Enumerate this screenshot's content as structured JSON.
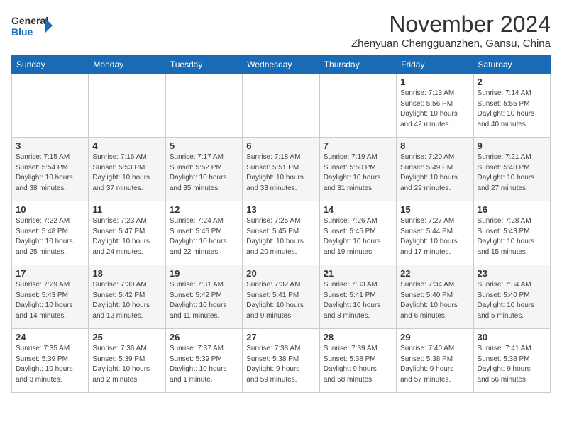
{
  "header": {
    "logo_line1": "General",
    "logo_line2": "Blue",
    "month": "November 2024",
    "location": "Zhenyuan Chengguanzhen, Gansu, China"
  },
  "weekdays": [
    "Sunday",
    "Monday",
    "Tuesday",
    "Wednesday",
    "Thursday",
    "Friday",
    "Saturday"
  ],
  "weeks": [
    [
      {
        "day": "",
        "info": ""
      },
      {
        "day": "",
        "info": ""
      },
      {
        "day": "",
        "info": ""
      },
      {
        "day": "",
        "info": ""
      },
      {
        "day": "",
        "info": ""
      },
      {
        "day": "1",
        "info": "Sunrise: 7:13 AM\nSunset: 5:56 PM\nDaylight: 10 hours\nand 42 minutes."
      },
      {
        "day": "2",
        "info": "Sunrise: 7:14 AM\nSunset: 5:55 PM\nDaylight: 10 hours\nand 40 minutes."
      }
    ],
    [
      {
        "day": "3",
        "info": "Sunrise: 7:15 AM\nSunset: 5:54 PM\nDaylight: 10 hours\nand 38 minutes."
      },
      {
        "day": "4",
        "info": "Sunrise: 7:16 AM\nSunset: 5:53 PM\nDaylight: 10 hours\nand 37 minutes."
      },
      {
        "day": "5",
        "info": "Sunrise: 7:17 AM\nSunset: 5:52 PM\nDaylight: 10 hours\nand 35 minutes."
      },
      {
        "day": "6",
        "info": "Sunrise: 7:18 AM\nSunset: 5:51 PM\nDaylight: 10 hours\nand 33 minutes."
      },
      {
        "day": "7",
        "info": "Sunrise: 7:19 AM\nSunset: 5:50 PM\nDaylight: 10 hours\nand 31 minutes."
      },
      {
        "day": "8",
        "info": "Sunrise: 7:20 AM\nSunset: 5:49 PM\nDaylight: 10 hours\nand 29 minutes."
      },
      {
        "day": "9",
        "info": "Sunrise: 7:21 AM\nSunset: 5:48 PM\nDaylight: 10 hours\nand 27 minutes."
      }
    ],
    [
      {
        "day": "10",
        "info": "Sunrise: 7:22 AM\nSunset: 5:48 PM\nDaylight: 10 hours\nand 25 minutes."
      },
      {
        "day": "11",
        "info": "Sunrise: 7:23 AM\nSunset: 5:47 PM\nDaylight: 10 hours\nand 24 minutes."
      },
      {
        "day": "12",
        "info": "Sunrise: 7:24 AM\nSunset: 5:46 PM\nDaylight: 10 hours\nand 22 minutes."
      },
      {
        "day": "13",
        "info": "Sunrise: 7:25 AM\nSunset: 5:45 PM\nDaylight: 10 hours\nand 20 minutes."
      },
      {
        "day": "14",
        "info": "Sunrise: 7:26 AM\nSunset: 5:45 PM\nDaylight: 10 hours\nand 19 minutes."
      },
      {
        "day": "15",
        "info": "Sunrise: 7:27 AM\nSunset: 5:44 PM\nDaylight: 10 hours\nand 17 minutes."
      },
      {
        "day": "16",
        "info": "Sunrise: 7:28 AM\nSunset: 5:43 PM\nDaylight: 10 hours\nand 15 minutes."
      }
    ],
    [
      {
        "day": "17",
        "info": "Sunrise: 7:29 AM\nSunset: 5:43 PM\nDaylight: 10 hours\nand 14 minutes."
      },
      {
        "day": "18",
        "info": "Sunrise: 7:30 AM\nSunset: 5:42 PM\nDaylight: 10 hours\nand 12 minutes."
      },
      {
        "day": "19",
        "info": "Sunrise: 7:31 AM\nSunset: 5:42 PM\nDaylight: 10 hours\nand 11 minutes."
      },
      {
        "day": "20",
        "info": "Sunrise: 7:32 AM\nSunset: 5:41 PM\nDaylight: 10 hours\nand 9 minutes."
      },
      {
        "day": "21",
        "info": "Sunrise: 7:33 AM\nSunset: 5:41 PM\nDaylight: 10 hours\nand 8 minutes."
      },
      {
        "day": "22",
        "info": "Sunrise: 7:34 AM\nSunset: 5:40 PM\nDaylight: 10 hours\nand 6 minutes."
      },
      {
        "day": "23",
        "info": "Sunrise: 7:34 AM\nSunset: 5:40 PM\nDaylight: 10 hours\nand 5 minutes."
      }
    ],
    [
      {
        "day": "24",
        "info": "Sunrise: 7:35 AM\nSunset: 5:39 PM\nDaylight: 10 hours\nand 3 minutes."
      },
      {
        "day": "25",
        "info": "Sunrise: 7:36 AM\nSunset: 5:39 PM\nDaylight: 10 hours\nand 2 minutes."
      },
      {
        "day": "26",
        "info": "Sunrise: 7:37 AM\nSunset: 5:39 PM\nDaylight: 10 hours\nand 1 minute."
      },
      {
        "day": "27",
        "info": "Sunrise: 7:38 AM\nSunset: 5:38 PM\nDaylight: 9 hours\nand 59 minutes."
      },
      {
        "day": "28",
        "info": "Sunrise: 7:39 AM\nSunset: 5:38 PM\nDaylight: 9 hours\nand 58 minutes."
      },
      {
        "day": "29",
        "info": "Sunrise: 7:40 AM\nSunset: 5:38 PM\nDaylight: 9 hours\nand 57 minutes."
      },
      {
        "day": "30",
        "info": "Sunrise: 7:41 AM\nSunset: 5:38 PM\nDaylight: 9 hours\nand 56 minutes."
      }
    ]
  ]
}
